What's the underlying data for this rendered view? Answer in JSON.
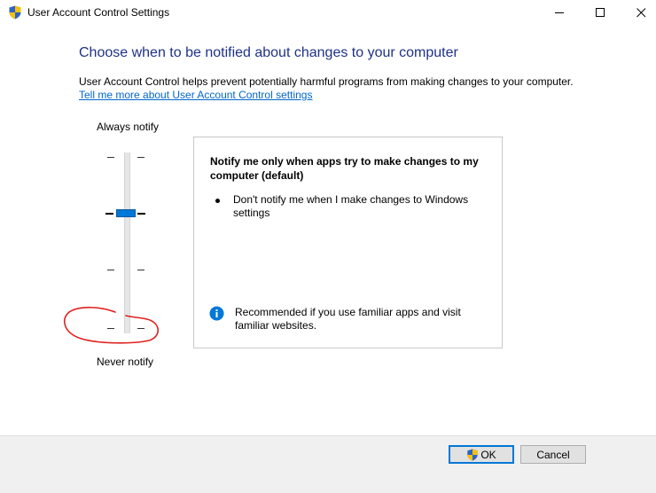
{
  "window": {
    "title": "User Account Control Settings"
  },
  "content": {
    "heading": "Choose when to be notified about changes to your computer",
    "description": "User Account Control helps prevent potentially harmful programs from making changes to your computer.",
    "help_link": "Tell me more about User Account Control settings"
  },
  "slider": {
    "top_label": "Always notify",
    "bottom_label": "Never notify",
    "levels": 4,
    "selected_level": 3
  },
  "panel": {
    "title": "Notify me only when apps try to make changes to my computer (default)",
    "bullet": "Don't notify me when I make changes to Windows settings",
    "info": "Recommended if you use familiar apps and visit familiar websites."
  },
  "buttons": {
    "ok": "OK",
    "cancel": "Cancel"
  },
  "colors": {
    "heading": "#1e3287",
    "link": "#0066cc",
    "thumb": "#0078d7",
    "annotation": "#e02020",
    "info_icon": "#0078d7"
  },
  "icons": {
    "title": "uac-shield-icon",
    "ok_button": "uac-shield-icon",
    "info": "info-icon"
  }
}
